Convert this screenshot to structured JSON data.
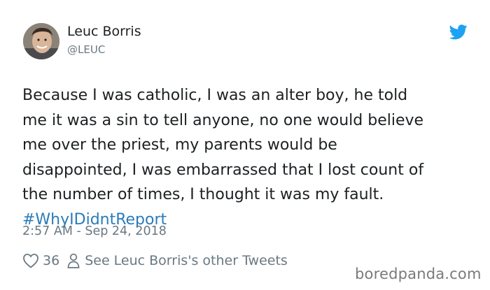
{
  "author": {
    "name": "Leuc Borris",
    "handle": "@LEUC"
  },
  "brand_icon": "twitter-bird-icon",
  "tweet": {
    "lines": [
      "Because I was catholic, I was an alter boy, he told",
      "me it was a sin to tell anyone, no one would believe",
      "me over the priest, my parents would be",
      "disappointed, I was embarrassed that I lost count of",
      "the number of times, I thought it was my fault."
    ],
    "hashtag": "#WhyIDidntReport",
    "timestamp": "2:57 AM - Sep 24, 2018"
  },
  "actions": {
    "like_icon": "heart-icon",
    "like_count": "36",
    "profile_icon": "person-icon",
    "profile_link": "See Leuc Borris's other Tweets"
  },
  "watermark": "boredpanda.com",
  "colors": {
    "text": "#1c2022",
    "secondary": "#697882",
    "link": "#2b7bb9",
    "twitter_blue": "#1da1f2",
    "watermark": "#7a7a7a"
  }
}
